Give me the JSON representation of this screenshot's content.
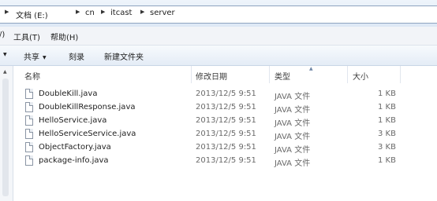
{
  "breadcrumb": [
    "文档 (E:)",
    "cn",
    "itcast",
    "server"
  ],
  "menu": [
    {
      "label": "/)"
    },
    {
      "label": "工具(T)"
    },
    {
      "label": "帮助(H)"
    }
  ],
  "toolbar": {
    "share_label": "共享",
    "burn_label": "刻录",
    "new_folder_label": "新建文件夹"
  },
  "columns": {
    "name": "名称",
    "date": "修改日期",
    "type": "类型",
    "size": "大小"
  },
  "files": [
    {
      "name": "DoubleKill.java",
      "date": "2013/12/5 9:51",
      "type": "JAVA 文件",
      "size": "1 KB"
    },
    {
      "name": "DoubleKillResponse.java",
      "date": "2013/12/5 9:51",
      "type": "JAVA 文件",
      "size": "1 KB"
    },
    {
      "name": "HelloService.java",
      "date": "2013/12/5 9:51",
      "type": "JAVA 文件",
      "size": "1 KB"
    },
    {
      "name": "HelloServiceService.java",
      "date": "2013/12/5 9:51",
      "type": "JAVA 文件",
      "size": "3 KB"
    },
    {
      "name": "ObjectFactory.java",
      "date": "2013/12/5 9:51",
      "type": "JAVA 文件",
      "size": "3 KB"
    },
    {
      "name": "package-info.java",
      "date": "2013/12/5 9:51",
      "type": "JAVA 文件",
      "size": "1 KB"
    }
  ]
}
